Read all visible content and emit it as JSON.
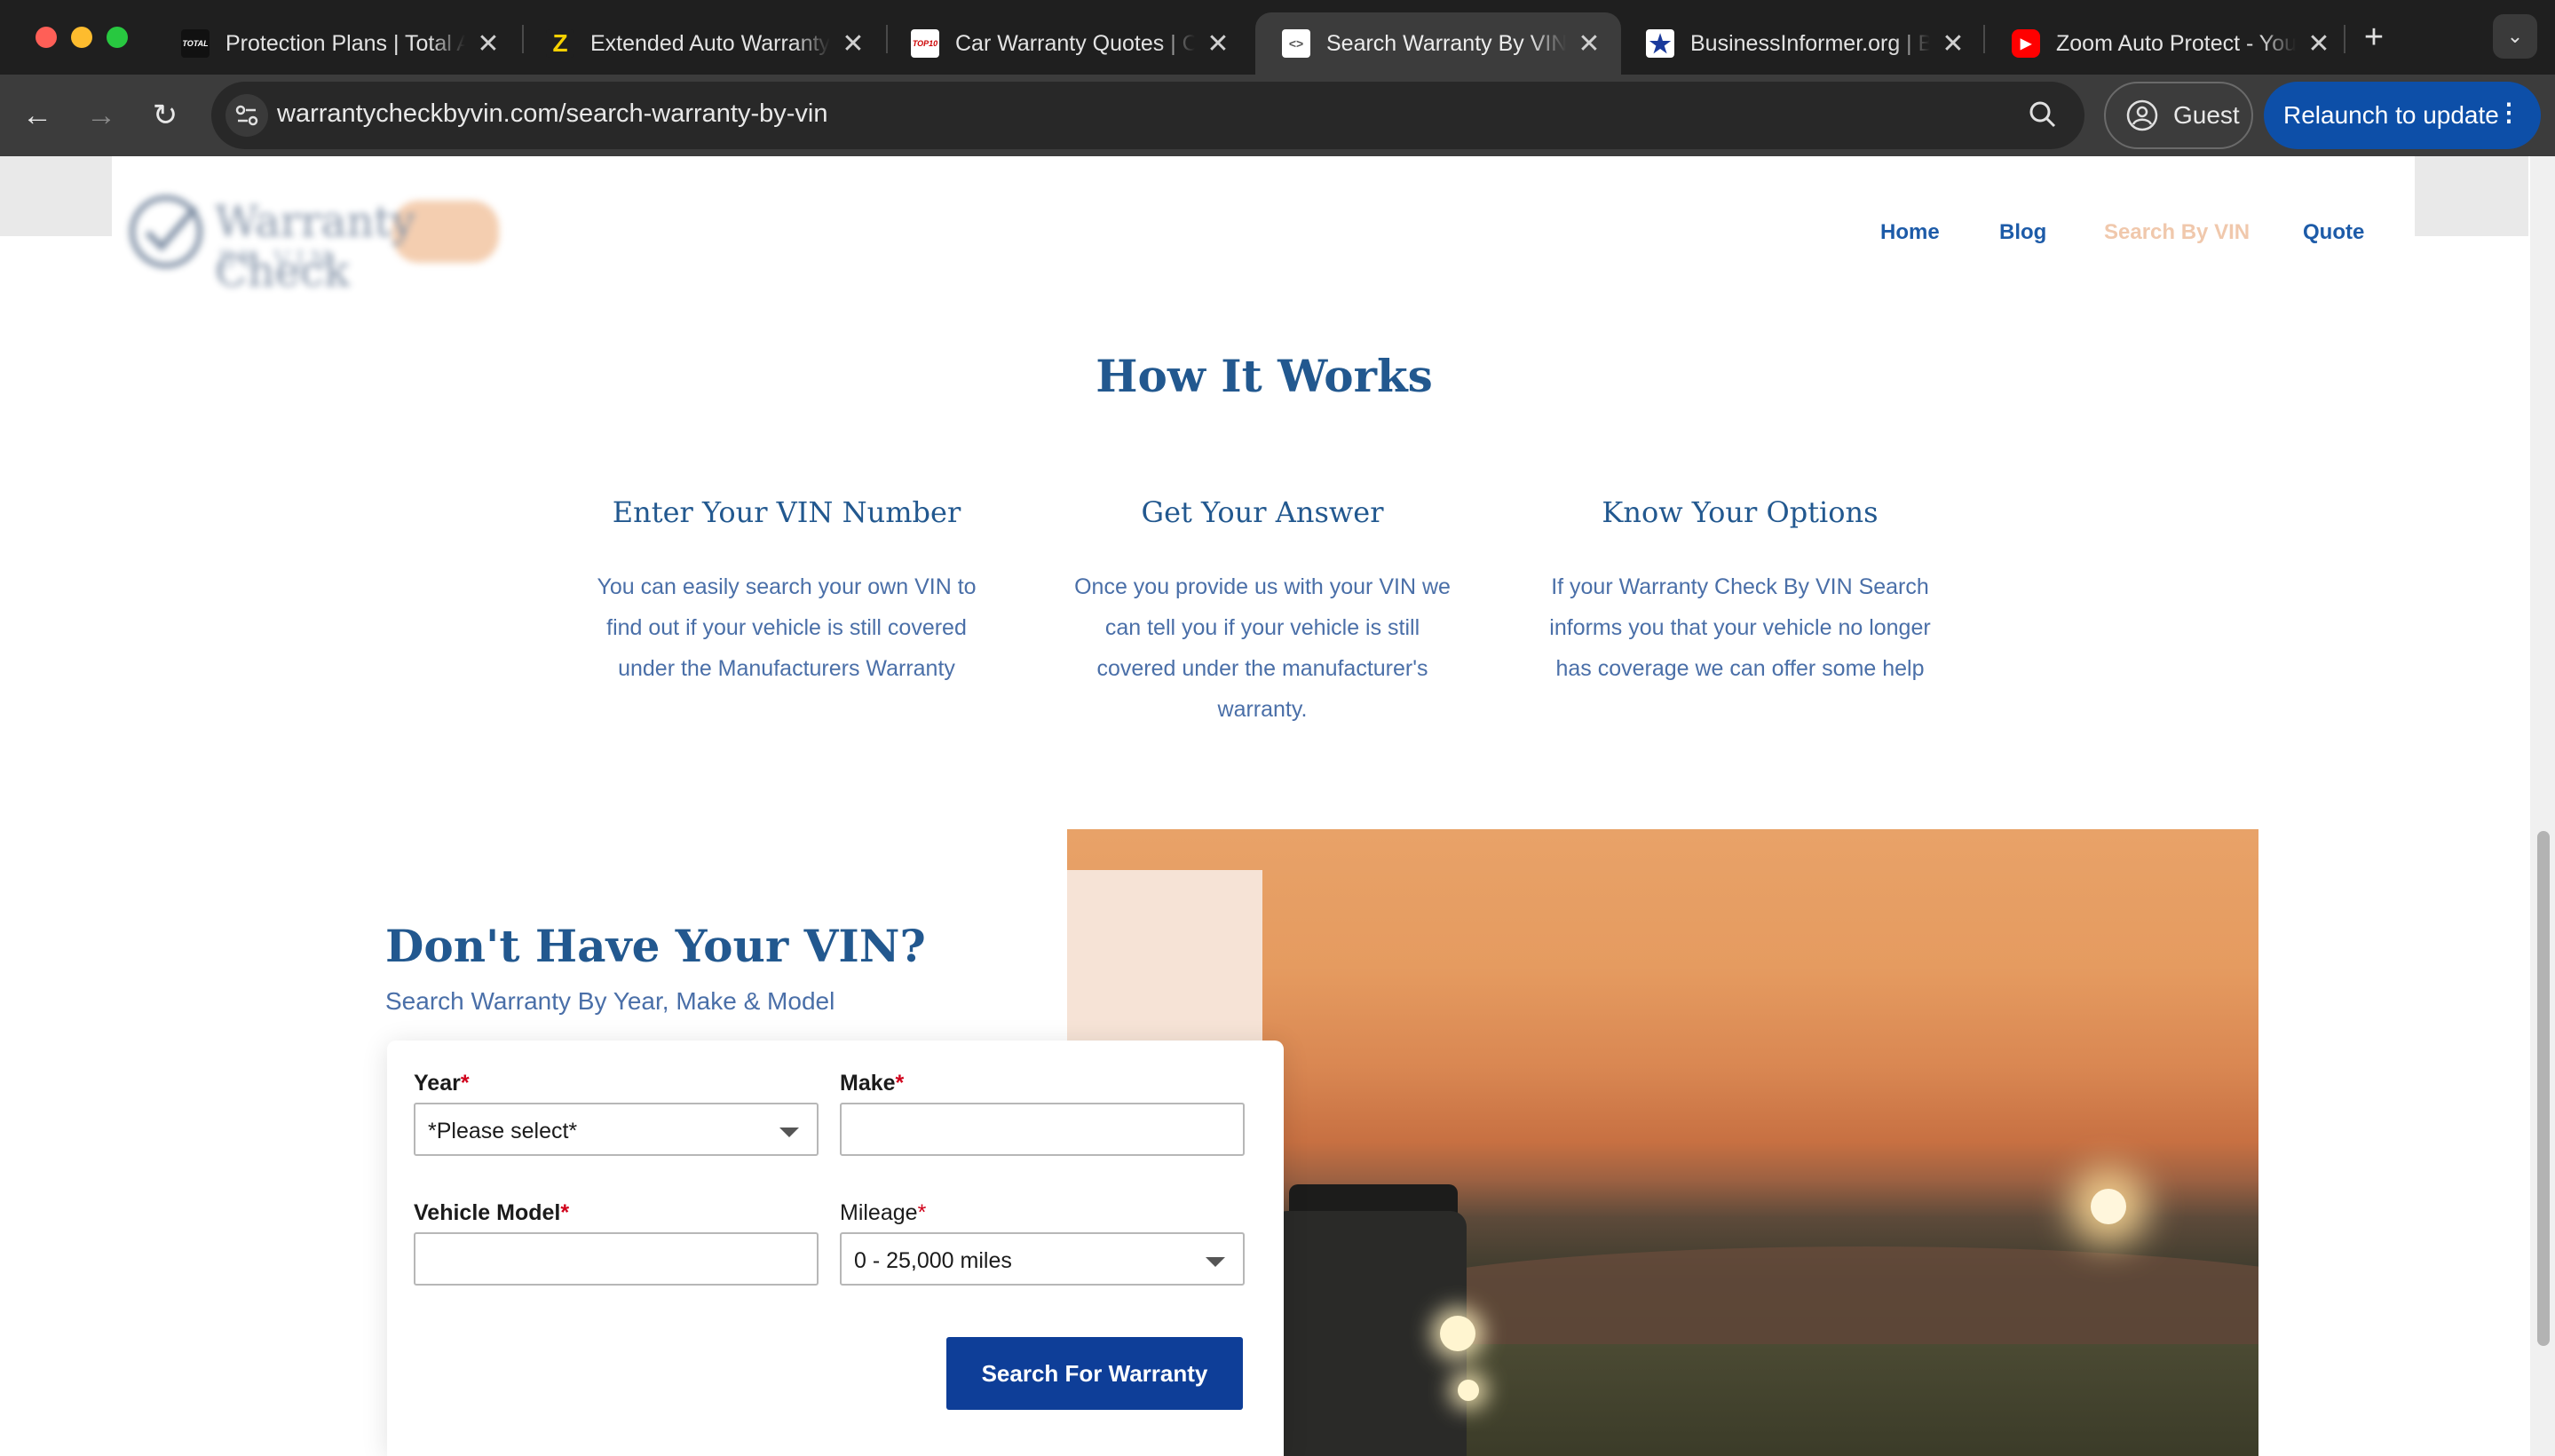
{
  "browser": {
    "tabs": [
      {
        "title": "Protection Plans | Total Auto",
        "favicon": "TOTAL",
        "active": false
      },
      {
        "title": "Extended Auto Warranty",
        "favicon": "Z",
        "active": false
      },
      {
        "title": "Car Warranty Quotes | Compare",
        "favicon": "TOP10",
        "active": false
      },
      {
        "title": "Search Warranty By VIN",
        "favicon": "<>",
        "active": true
      },
      {
        "title": "BusinessInformer.org | Business",
        "favicon": "★",
        "active": false
      },
      {
        "title": "Zoom Auto Protect - YouTube",
        "favicon": "▶",
        "active": false
      }
    ],
    "url": "warrantycheckbyvin.com/search-warranty-by-vin",
    "profile_label": "Guest",
    "relaunch_label": "Relaunch to update"
  },
  "site": {
    "logo_text": "Warranty Check",
    "logo_subtext": "BY VIN",
    "nav": [
      "Home",
      "Blog",
      "Search By VIN",
      "Quote"
    ],
    "current_nav": "Search By VIN"
  },
  "how_it_works": {
    "title": "How It Works",
    "steps": [
      {
        "title": "Enter Your VIN Number",
        "body": "You can easily search your own VIN to find out if your vehicle is still covered under the Manufacturers Warranty"
      },
      {
        "title": "Get Your Answer",
        "body": "Once you provide us with your VIN we can tell you if your vehicle is still covered under the manufacturer's warranty."
      },
      {
        "title": "Know Your Options",
        "body": "If your Warranty Check By VIN Search informs you that your vehicle no longer has coverage we can offer some help"
      }
    ]
  },
  "vin_section": {
    "title": "Don't Have Your VIN?",
    "subtitle": "Search Warranty By Year, Make & Model"
  },
  "form": {
    "year_label": "Year",
    "year_value": "*Please select*",
    "make_label": "Make",
    "make_value": "",
    "model_label": "Vehicle Model",
    "model_value": "",
    "mileage_label": "Mileage",
    "mileage_value": "0 - 25,000 miles",
    "required_marker": "*",
    "submit_label": "Search For Warranty"
  },
  "colors": {
    "brand_blue": "#22588f",
    "nav_blue": "#1d5ba8",
    "button_blue": "#0e3e98",
    "active_nav_peach": "#f0c8ac",
    "relaunch_blue": "#0d4fa8"
  }
}
